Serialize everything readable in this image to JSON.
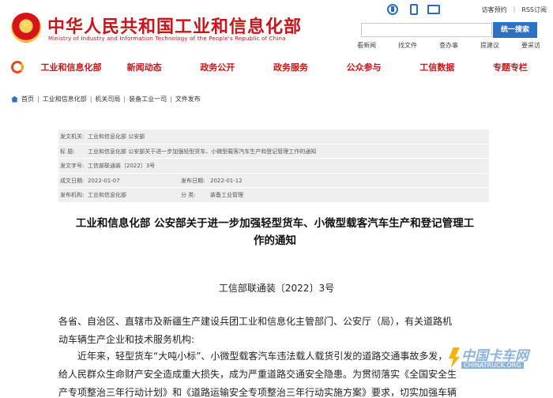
{
  "header": {
    "site_title": "中华人民共和国工业和信息化部",
    "site_subtitle": "Ministry of Industry and Information Technology of the People's Republic of China",
    "top_links": [
      "访客预约",
      "RSS订阅"
    ],
    "search_button": "统一搜索",
    "sub_links": [
      "看新闻",
      "找文件",
      "查办事",
      "提建议",
      "要采访"
    ],
    "tool_icons": [
      "accessibility-icon",
      "mobile-icon",
      "mail-icon"
    ]
  },
  "nav": {
    "items": [
      "工业和信息化部",
      "新闻动态",
      "政务公开",
      "政务服务",
      "公众参与",
      "工信数据",
      "专题专栏"
    ]
  },
  "breadcrumb": [
    "首页",
    "工业和信息化部",
    "机关司局",
    "装备工业一司",
    "文件发布"
  ],
  "info": {
    "issuer_label": "发文机关:",
    "issuer": "工业和信息化部 公安部",
    "title_label": "标      题:",
    "title": "工业和信息化部 公安部关于进一步加强轻型货车、小微型载客汽车生产和登记管理工作的通知",
    "docno_label": "发文字号:",
    "docno": "工信部联通装〔2022〕3号",
    "created_label": "成文日期:",
    "created": "2022-01-07",
    "published_label": "发布日期:",
    "published": "2022-01-12",
    "agency_label": "发布机构:",
    "agency": "工业和信息化部",
    "category_label": "分      类:",
    "category": "装备工业管理"
  },
  "article": {
    "title_line1": "工业和信息化部 公安部关于进一步加强轻型货车、小微型载客汽车生产和登记管理工",
    "title_line2": "作的通知",
    "doc_number": "工信部联通装〔2022〕3号",
    "para1_line1": "各省、自治区、直辖市及新疆生产建设兵团工业和信息化主管部门、公安厅（局），有关道路机",
    "para1_line2": "动车辆生产企业和技术服务机构:",
    "para2_line1": "近年来，轻型货车“大吨小标”、小微型载客汽车违法载人载货引发的道路交通事故多发，",
    "para2_line2": "给人民群众生命财产安全造成重大损失，成为严重道路交通安全隐患。为贯彻落实《全国安全生",
    "para2_line3": "产专项整治三年行动计划》和《道路运输安全专项整治三年行动实施方案》要求，切实加强车辆"
  },
  "watermark": {
    "main": "中国卡车网",
    "sub": "CHINATRUCK.ORG"
  }
}
